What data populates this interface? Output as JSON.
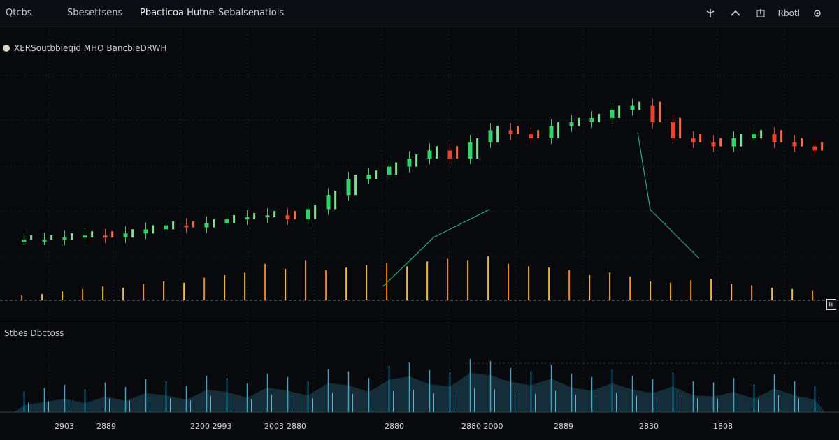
{
  "toolbar": {
    "tabs": [
      {
        "label": "Qtcbs"
      },
      {
        "label": "Sbesettsens"
      },
      {
        "label": "Pbacticoa Hutne"
      },
      {
        "label": "Sebalsenatiols"
      }
    ],
    "right_label": "Rbotl"
  },
  "legend": {
    "label": "XERSoutbbieqid MHO BancbieDRWH"
  },
  "lower_pane": {
    "label": "Stbes Dbctoss"
  },
  "x_axis_labels": [
    "2903",
    "2889",
    "2200 2993",
    "2003",
    "2880",
    "2880",
    "2880 2000",
    "2889",
    "2830",
    "1808"
  ],
  "colors": {
    "background": "#07090d",
    "grid": "#1b2129",
    "up": "#2fd36a",
    "down": "#e8432f",
    "volume_orange": "#f08a24",
    "volume_blue": "#3aa7c9",
    "trendline": "#18b487"
  },
  "chart_data": {
    "type": "candlestick",
    "price_pane": {
      "values": [
        30,
        30,
        31,
        32,
        31,
        33,
        35,
        37,
        36,
        38,
        40,
        41,
        42,
        40,
        45,
        52,
        60,
        62,
        66,
        70,
        74,
        70,
        78,
        84,
        82,
        80,
        86,
        88,
        90,
        94,
        96,
        88,
        80,
        78,
        76,
        80,
        82,
        78,
        76,
        74
      ],
      "volume": [
        8,
        10,
        14,
        18,
        22,
        20,
        26,
        30,
        28,
        36,
        40,
        44,
        58,
        50,
        64,
        48,
        52,
        56,
        60,
        54,
        62,
        66,
        64,
        70,
        58,
        54,
        52,
        48,
        40,
        44,
        38,
        30,
        28,
        32,
        34,
        26,
        24,
        20,
        18,
        16
      ]
    },
    "lower_pane_values": [
      12,
      18,
      24,
      16,
      28,
      20,
      34,
      30,
      22,
      40,
      36,
      26,
      44,
      38,
      30,
      52,
      48,
      36,
      58,
      64,
      50,
      46,
      70,
      66,
      54,
      48,
      60,
      44,
      38,
      52,
      40,
      34,
      46,
      30,
      28,
      36,
      24,
      42,
      30,
      22
    ]
  }
}
